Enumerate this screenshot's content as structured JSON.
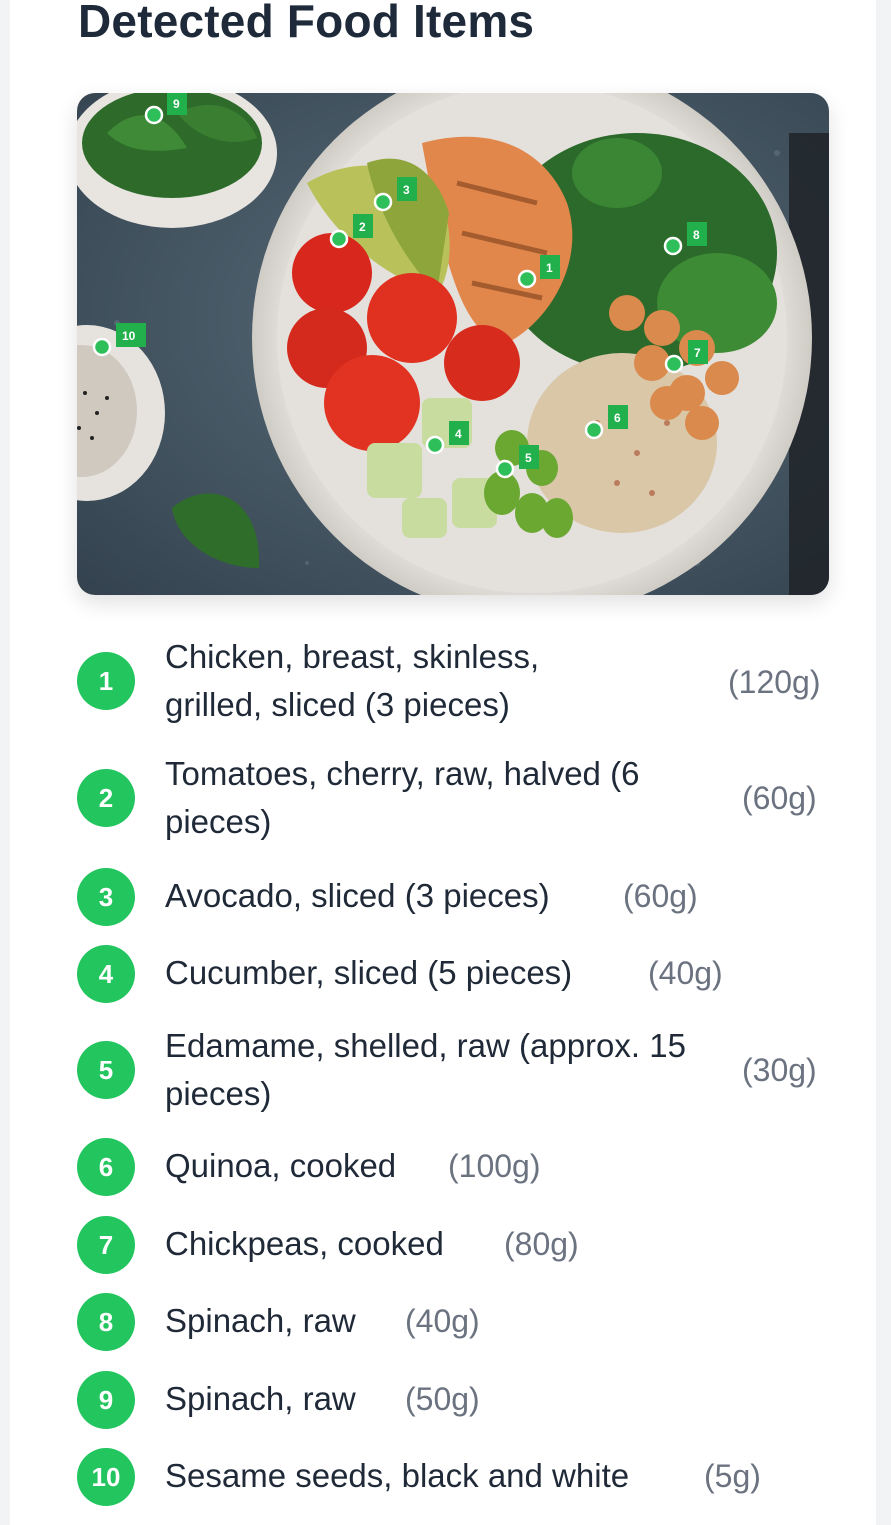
{
  "page": {
    "title": "Detected Food Items"
  },
  "colors": {
    "badge": "#22c55e",
    "marker": "#21b04b",
    "weight_text": "#6b7280",
    "title_text": "#1e2a3a"
  },
  "image": {
    "description_icon": "food-photo"
  },
  "items": [
    {
      "number": "1",
      "name": "Chicken, breast, skinless, grilled, sliced (3 pieces)",
      "weight": "(120g)"
    },
    {
      "number": "2",
      "name": "Tomatoes, cherry, raw, halved (6 pieces)",
      "weight": "(60g)"
    },
    {
      "number": "3",
      "name": "Avocado, sliced (3 pieces)",
      "weight": "(60g)"
    },
    {
      "number": "4",
      "name": "Cucumber, sliced (5 pieces)",
      "weight": "(40g)"
    },
    {
      "number": "5",
      "name": "Edamame, shelled, raw (approx. 15 pieces)",
      "weight": "(30g)"
    },
    {
      "number": "6",
      "name": "Quinoa, cooked",
      "weight": "(100g)"
    },
    {
      "number": "7",
      "name": "Chickpeas, cooked",
      "weight": "(80g)"
    },
    {
      "number": "8",
      "name": "Spinach, raw",
      "weight": "(40g)"
    },
    {
      "number": "9",
      "name": "Spinach, raw",
      "weight": "(50g)"
    },
    {
      "number": "10",
      "name": "Sesame seeds, black and white",
      "weight": "(5g)"
    }
  ]
}
